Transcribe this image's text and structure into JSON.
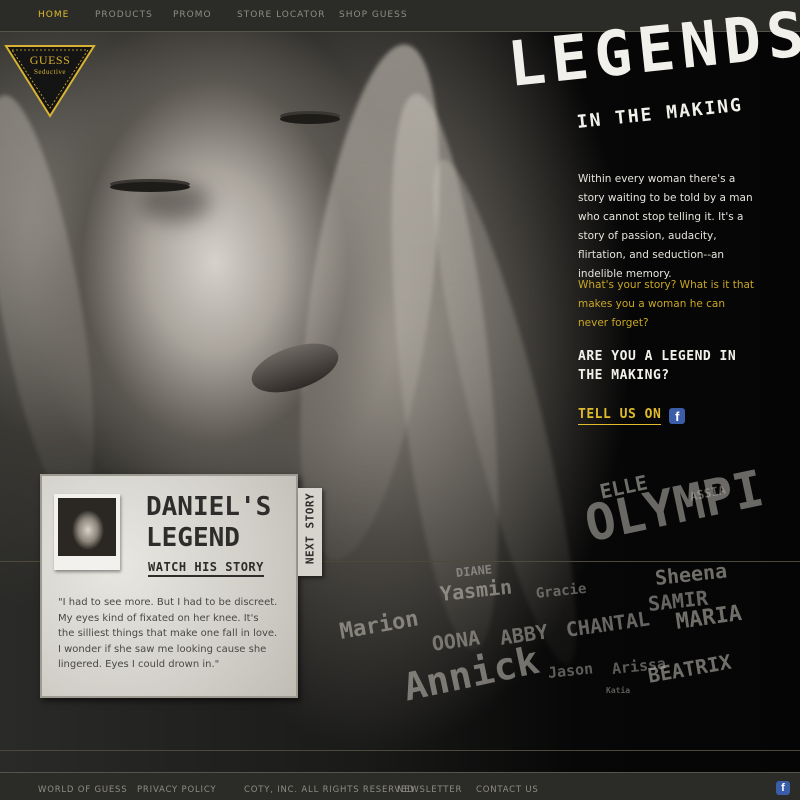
{
  "nav": {
    "items": [
      "HOME",
      "PRODUCTS",
      "PROMO",
      "STORE LOCATOR",
      "SHOP GUESS"
    ]
  },
  "logo": {
    "brand": "GUESS",
    "product": "Seductive"
  },
  "hero": {
    "title": "LEGENDS",
    "subtitle": "IN THE MAKING",
    "intro": "Within every woman there's a story waiting to be told by a man who cannot stop telling it. It's a story of passion, audacity, flirtation, and seduction--an indelible memory.",
    "question": "What's your story? What is it that makes you a woman he can never forget?",
    "legend_question": "ARE YOU A LEGEND IN THE MAKING?",
    "tell_us": "TELL US ON",
    "cloud_names": [
      "ELLE",
      "ASSIA",
      "OLYMPI",
      "DIANE",
      "Yasmin",
      "Gracie",
      "Sheena",
      "SAMIR",
      "Marion",
      "OONA",
      "ABBY",
      "CHANTAL",
      "MARIA",
      "Annick",
      "Jason",
      "Arissa",
      "BEATRIX",
      "Katia"
    ]
  },
  "story": {
    "name": "DANIEL'S LEGEND",
    "watch": "WATCH HIS STORY",
    "quote": "\"I had to see more. But I had to be discreet. My eyes kind of fixated on her knee. It's the silliest things that make one fall in love. I wonder if she saw me looking cause she lingered. Eyes I could drown in.\"",
    "next": "NEXT STORY"
  },
  "footer": {
    "links": [
      "WORLD OF GUESS",
      "PRIVACY POLICY",
      "COTY, INC. ALL RIGHTS RESERVED",
      "NEWSLETTER",
      "CONTACT US"
    ]
  },
  "colors": {
    "accent": "#e0bc2c",
    "nav_bg": "#2b2b28",
    "facebook": "#3b5ca8"
  },
  "icons": {
    "facebook": "facebook-icon"
  }
}
